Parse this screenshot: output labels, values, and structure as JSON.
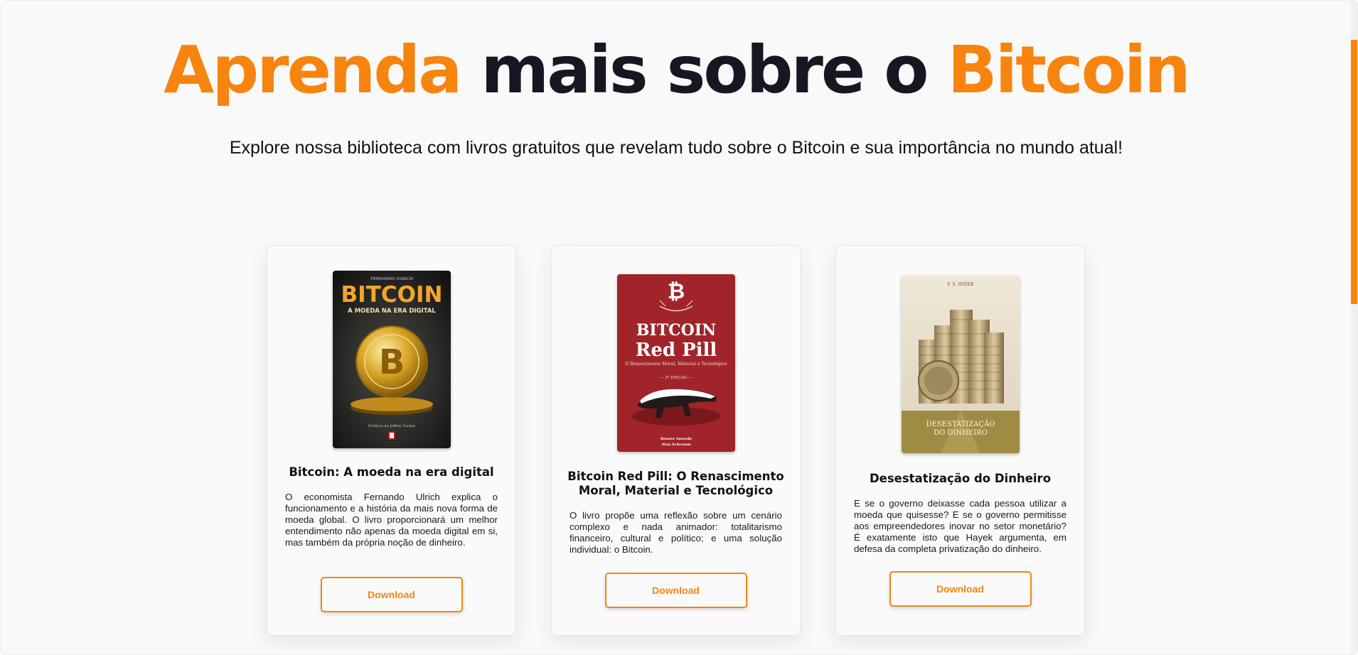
{
  "hero": {
    "title_part1": "Aprenda",
    "title_part2": " mais sobre o ",
    "title_part3": "Bitcoin",
    "subtitle": "Explore nossa biblioteca com livros gratuitos que revelam tudo sobre o Bitcoin e sua importância no mundo atual!"
  },
  "colors": {
    "accent": "#f7840f",
    "title_dark": "#161722",
    "background": "#f9f9f9"
  },
  "books": [
    {
      "title": "Bitcoin: A moeda na era digital",
      "description": "O economista Fernando Ulrich explica o funcionamento e a história da mais nova forma de moeda global. O livro proporcionará um melhor entendimento não apenas da moeda digital em si, mas também da própria noção de dinheiro.",
      "download_label": "Download",
      "cover": {
        "author": "FERNANDO ULRICH",
        "title": "BITCOIN",
        "subtitle": "A MOEDA NA ERA DIGITAL",
        "preface": "Prefácio de Jeffrey Tucker"
      }
    },
    {
      "title": "Bitcoin Red Pill: O Renascimento Moral, Material e Tecnológico",
      "description": "O livro propõe uma reflexão sobre um cenário complexo e nada animador: totalitarismo financeiro, cultural e político; e uma solução individual: o Bitcoin.",
      "download_label": "Download",
      "cover": {
        "title_line1": "BITCOIN",
        "title_line2": "Red Pill",
        "subtitle": "O Renascimento Moral, Material e Tecnológico",
        "edition": "— 2ª EDIÇÃO —",
        "author1": "Renato Amoedo",
        "author2": "Alan Schramm"
      }
    },
    {
      "title": "Desestatização do Dinheiro",
      "description": "E se o governo deixasse cada pessoa utilizar a moeda que quisesse? E se o governo permitisse aos empreendedores inovar no setor monetário? É exatamente isto que Hayek argumenta, em defesa da completa privatização do dinheiro.",
      "download_label": "Download",
      "cover": {
        "author": "F. A. HAYEK",
        "title_line1": "DESESTATIZAÇÃO",
        "title_line2": "DO DINHEIRO"
      }
    }
  ]
}
